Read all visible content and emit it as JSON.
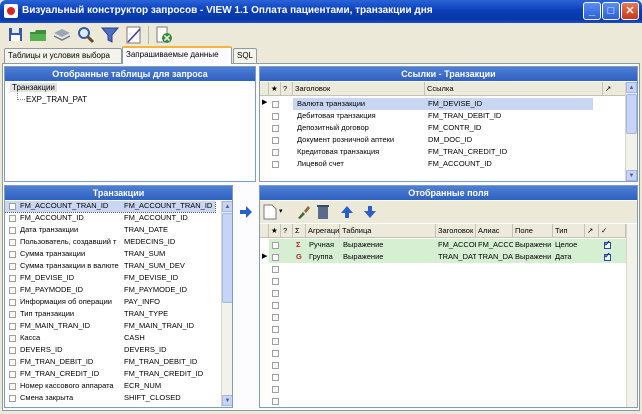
{
  "window": {
    "title": "Визуальный конструктор запросов - VIEW 1.1 Оплата пациентами, транзакции дня",
    "min_glyph": "_",
    "max_glyph": "□",
    "close_glyph": "✕"
  },
  "tabs": [
    {
      "label": "Таблицы и условия выбора"
    },
    {
      "label": "Запрашиваемые данные"
    },
    {
      "label": "SQL"
    }
  ],
  "selected_tables": {
    "header": "Отобранные таблицы для запроса",
    "root": "Транзакции",
    "child": "EXP_TRAN_PAT"
  },
  "links": {
    "header": "Ссылки - Транзакции",
    "col_star": "★",
    "col_q": "?",
    "col_title": "Заголовок",
    "col_ref": "Ссылка",
    "rows": [
      {
        "title": "Валюта транзакции",
        "ref": "FM_DEVISE_ID",
        "selected": true
      },
      {
        "title": "Дебитовая транзакция",
        "ref": "FM_TRAN_DEBIT_ID"
      },
      {
        "title": "Депозитный договор",
        "ref": "FM_CONTR_ID"
      },
      {
        "title": "Документ розничной аптеки",
        "ref": "DM_DOC_ID"
      },
      {
        "title": "Кредитовая транзакция",
        "ref": "FM_TRAN_CREDIT_ID"
      },
      {
        "title": "Лицевой счет",
        "ref": "FM_ACCOUNT_ID"
      }
    ]
  },
  "transactions": {
    "header": "Транзакции",
    "rows": [
      {
        "title": "FM_ACCOUNT_TRAN_ID",
        "field": "FM_ACCOUNT_TRAN_ID",
        "selected": true
      },
      {
        "title": "FM_ACCOUNT_ID",
        "field": "FM_ACCOUNT_ID"
      },
      {
        "title": "Дата транзакции",
        "field": "TRAN_DATE"
      },
      {
        "title": "Пользователь, создавший т",
        "field": "MEDECINS_ID"
      },
      {
        "title": "Сумма транзакции",
        "field": "TRAN_SUM"
      },
      {
        "title": "Сумма транзакции в валюте",
        "field": "TRAN_SUM_DEV"
      },
      {
        "title": "FM_DEVISE_ID",
        "field": "FM_DEVISE_ID"
      },
      {
        "title": "FM_PAYMODE_ID",
        "field": "FM_PAYMODE_ID"
      },
      {
        "title": "Информация об операции",
        "field": "PAY_INFO"
      },
      {
        "title": "Тип транзакции",
        "field": "TRAN_TYPE"
      },
      {
        "title": "FM_MAIN_TRAN_ID",
        "field": "FM_MAIN_TRAN_ID"
      },
      {
        "title": "Касса",
        "field": "CASH"
      },
      {
        "title": "DEVERS_ID",
        "field": "DEVERS_ID"
      },
      {
        "title": "FM_TRAN_DEBIT_ID",
        "field": "FM_TRAN_DEBIT_ID"
      },
      {
        "title": "FM_TRAN_CREDIT_ID",
        "field": "FM_TRAN_CREDIT_ID"
      },
      {
        "title": "Номер кассового аппарата",
        "field": "ECR_NUM"
      },
      {
        "title": "Смена закрыта",
        "field": "SHIFT_CLOSED"
      }
    ]
  },
  "selected_fields": {
    "header": "Отобранные поля",
    "cols": {
      "star": "★",
      "q": "?",
      "sigma": "Σ",
      "agg": "Агрегация",
      "table": "Таблица",
      "title": "Заголовок",
      "alias": "Алиас",
      "field": "Поле",
      "type": "Тип"
    },
    "rows": [
      {
        "sigma": "Σ",
        "agg": "Ручная",
        "table": "Выражение",
        "title": "FM_ACCOL",
        "alias": "FM_ACCOL",
        "field": "Выражени",
        "type": "Целое",
        "checked": true
      },
      {
        "sigma": "G",
        "agg": "Группа",
        "table": "Выражение",
        "title": "TRAN_DAT",
        "alias": "TRAN_DAT",
        "field": "Выражени",
        "type": "Дата",
        "checked": true
      }
    ]
  },
  "colors": {
    "header_blue": "#2f61c0",
    "row_green": "#d6efd2",
    "row_selected": "#c8d6f2"
  }
}
